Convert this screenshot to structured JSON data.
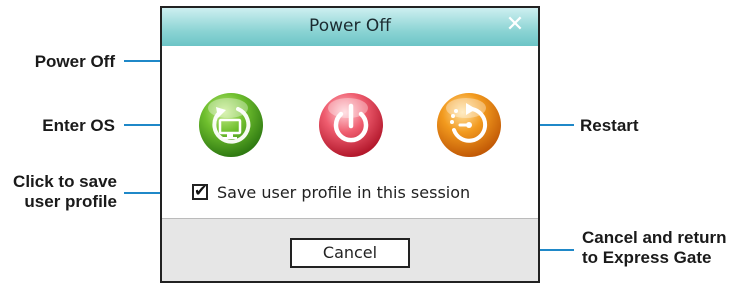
{
  "dialog": {
    "title": "Power Off",
    "close_glyph": "✕",
    "actions": [
      {
        "name": "enter-os",
        "icon": "monitor-refresh-icon",
        "color": "#5aa82a"
      },
      {
        "name": "power-off",
        "icon": "power-icon",
        "color": "#e8485a"
      },
      {
        "name": "restart",
        "icon": "restart-icon",
        "color": "#ef8a12"
      }
    ],
    "save_profile": {
      "checked": true,
      "check_glyph": "✔",
      "label": "Save user profile in this session"
    },
    "cancel_label": "Cancel"
  },
  "callouts": {
    "power_off": "Power Off",
    "enter_os": "Enter OS",
    "restart": "Restart",
    "save_profile_line1": "Click to save",
    "save_profile_line2": "user profile",
    "cancel_line1": "Cancel and return",
    "cancel_line2": "to Express Gate"
  },
  "colors": {
    "leader_line": "#1f88c8",
    "titlebar": "#8cd4d4"
  }
}
